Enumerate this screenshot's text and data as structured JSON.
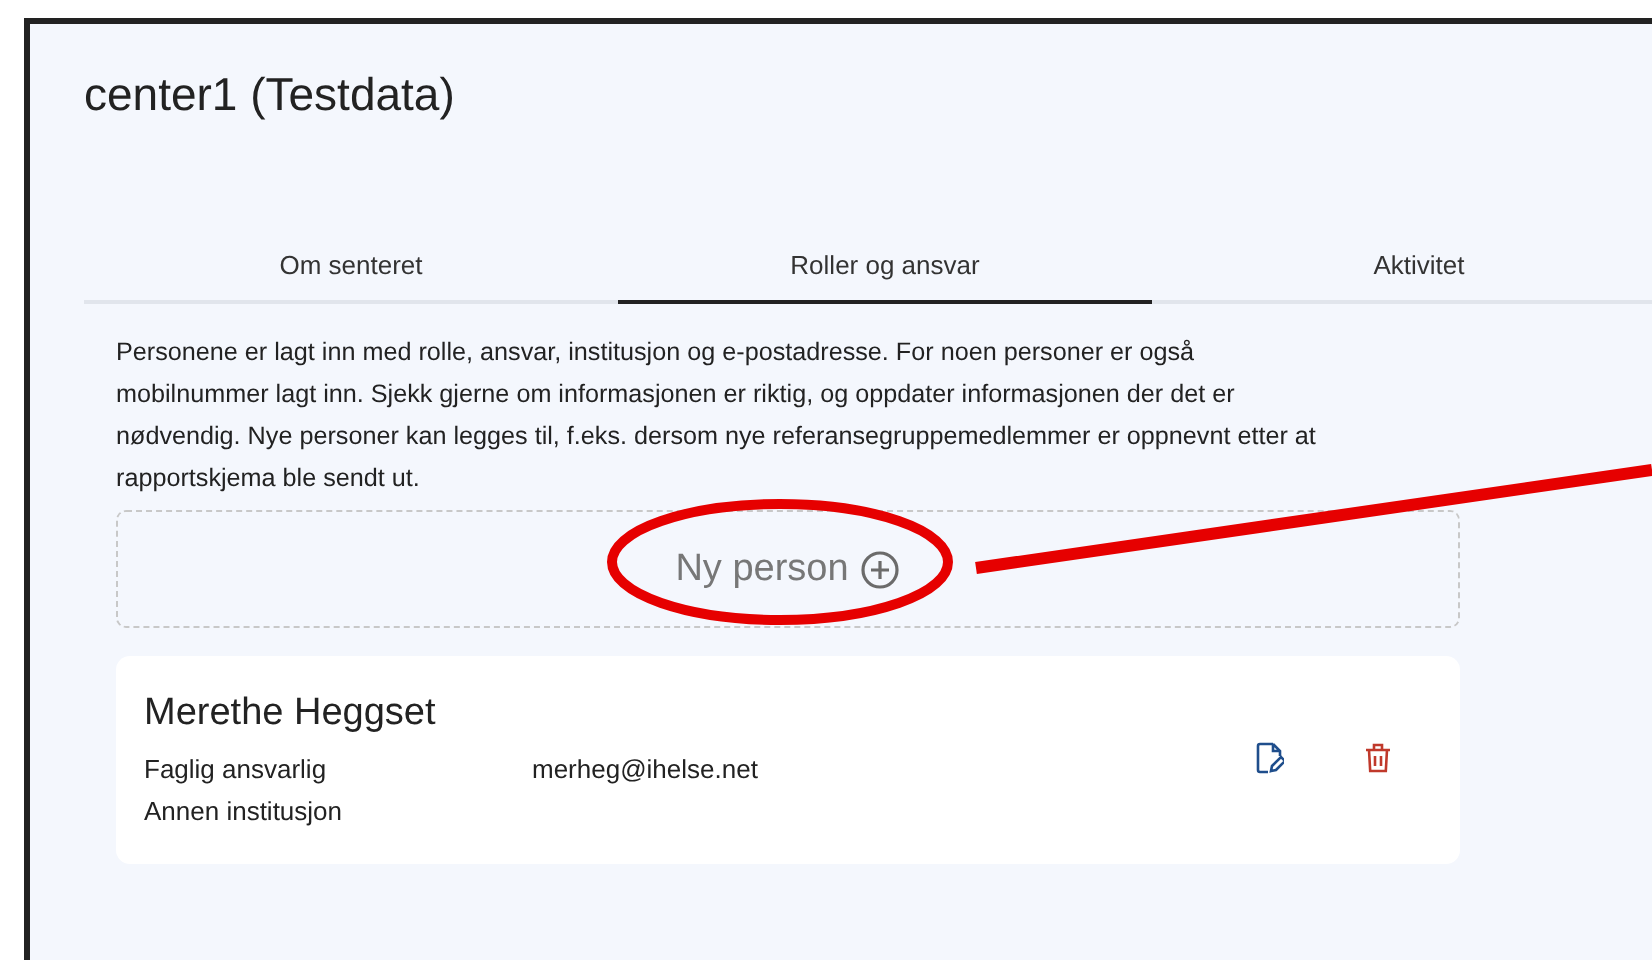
{
  "page": {
    "title": "center1 (Testdata)"
  },
  "tabs": [
    {
      "label": "Om senteret",
      "selected": false
    },
    {
      "label": "Roller og ansvar",
      "selected": true
    },
    {
      "label": "Aktivitet",
      "selected": false
    }
  ],
  "intro": "Personene er lagt inn med rolle, ansvar, institusjon og e-postadresse. For noen personer er også mobilnummer lagt inn. Sjekk gjerne om informasjonen er riktig, og oppdater informasjonen der det er nødvendig. Nye personer kan legges til, f.eks. dersom nye referansegruppemedlemmer er oppnevnt etter at rapportskjema ble sendt ut.",
  "add_button": {
    "label": "Ny person"
  },
  "persons": [
    {
      "name": "Merethe Heggset",
      "role": "Faglig ansvarlig",
      "institution": "Annen institusjon",
      "email": "merheg@ihelse.net"
    }
  ]
}
